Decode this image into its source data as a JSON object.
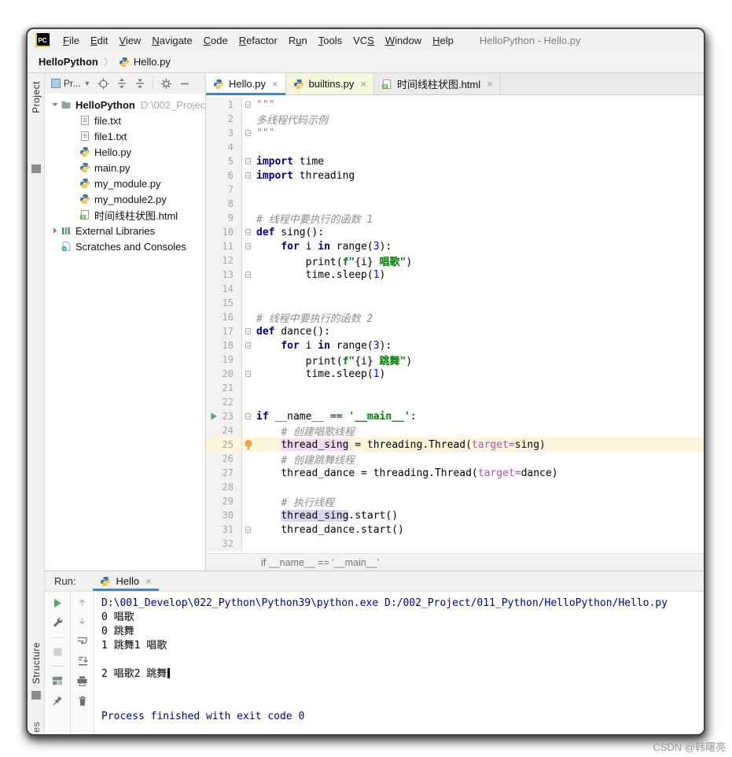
{
  "window": {
    "title": "HelloPython - Hello.py"
  },
  "menu": {
    "logo": "PC",
    "items": [
      {
        "label": "File",
        "u": 0
      },
      {
        "label": "Edit",
        "u": 0
      },
      {
        "label": "View",
        "u": 0
      },
      {
        "label": "Navigate",
        "u": 0
      },
      {
        "label": "Code",
        "u": 0
      },
      {
        "label": "Refactor",
        "u": 0
      },
      {
        "label": "Run",
        "u": 1
      },
      {
        "label": "Tools",
        "u": 0
      },
      {
        "label": "VCS",
        "u": 2
      },
      {
        "label": "Window",
        "u": 0
      },
      {
        "label": "Help",
        "u": 0
      }
    ]
  },
  "breadcrumb": {
    "project": "HelloPython",
    "separator": "〉",
    "file": "Hello.py"
  },
  "tool_stripe": {
    "top": "Project",
    "bottom": "Structure",
    "bottom_partial": "es"
  },
  "project_panel": {
    "selector_label": "Pr...",
    "tree": [
      {
        "label": "HelloPython",
        "path": "D:\\002_Projec",
        "icon": "folder",
        "level": 0,
        "bold": true,
        "chevron": "down"
      },
      {
        "label": "file.txt",
        "icon": "textfile",
        "level": 1
      },
      {
        "label": "file1.txt",
        "icon": "textfile",
        "level": 1
      },
      {
        "label": "Hello.py",
        "icon": "python",
        "level": 1
      },
      {
        "label": "main.py",
        "icon": "python",
        "level": 1
      },
      {
        "label": "my_module.py",
        "icon": "python",
        "level": 1
      },
      {
        "label": "my_module2.py",
        "icon": "python",
        "level": 1
      },
      {
        "label": "时间线柱状图.html",
        "icon": "htmlfile",
        "level": 1
      },
      {
        "label": "External Libraries",
        "icon": "lib",
        "level": 0,
        "chevron": "right"
      },
      {
        "label": "Scratches and Consoles",
        "icon": "scratch",
        "level": 0
      }
    ]
  },
  "editor": {
    "tabs": [
      {
        "label": "Hello.py",
        "icon": "python",
        "state": "active"
      },
      {
        "label": "builtins.py",
        "icon": "python",
        "state": "nonproject"
      },
      {
        "label": "时间线柱状图.html",
        "icon": "htmlfile",
        "state": "normal"
      }
    ],
    "context_bar": "if __name__ == '__main__'",
    "code": [
      {
        "seg": [
          [
            "\"\"\"",
            "com"
          ]
        ],
        "fold": true
      },
      {
        "seg": [
          [
            "多线程代码示例",
            "com"
          ]
        ]
      },
      {
        "seg": [
          [
            "\"\"\"",
            "com"
          ]
        ],
        "fold": true
      },
      {
        "seg": []
      },
      {
        "seg": [
          [
            "import",
            "kw"
          ],
          [
            " time",
            "pln"
          ]
        ],
        "fold": true
      },
      {
        "seg": [
          [
            "import",
            "kw"
          ],
          [
            " threading",
            "pln"
          ]
        ],
        "fold": true
      },
      {
        "seg": []
      },
      {
        "seg": []
      },
      {
        "seg": [
          [
            "# 线程中要执行的函数 1",
            "com"
          ]
        ]
      },
      {
        "seg": [
          [
            "def",
            "kw"
          ],
          [
            " sing():",
            "pln"
          ]
        ],
        "fold": true
      },
      {
        "seg": [
          [
            "    ",
            "pln"
          ],
          [
            "for",
            "kw"
          ],
          [
            " i ",
            "pln"
          ],
          [
            "in",
            "kw"
          ],
          [
            " range(",
            "pln"
          ],
          [
            "3",
            "num"
          ],
          [
            "):",
            "pln"
          ]
        ],
        "fold": true
      },
      {
        "seg": [
          [
            "        print(",
            "pln"
          ],
          [
            "f\"",
            "str"
          ],
          [
            "{i}",
            "pln"
          ],
          [
            " 唱歌\"",
            "str"
          ],
          [
            ")",
            "pln"
          ]
        ]
      },
      {
        "seg": [
          [
            "        time.sleep(",
            "pln"
          ],
          [
            "1",
            "num"
          ],
          [
            ")",
            "pln"
          ]
        ],
        "fold": true
      },
      {
        "seg": []
      },
      {
        "seg": []
      },
      {
        "seg": [
          [
            "# 线程中要执行的函数 2",
            "com"
          ]
        ]
      },
      {
        "seg": [
          [
            "def",
            "kw"
          ],
          [
            " dance():",
            "pln"
          ]
        ],
        "fold": true
      },
      {
        "seg": [
          [
            "    ",
            "pln"
          ],
          [
            "for",
            "kw"
          ],
          [
            " i ",
            "pln"
          ],
          [
            "in",
            "kw"
          ],
          [
            " range(",
            "pln"
          ],
          [
            "3",
            "num"
          ],
          [
            "):",
            "pln"
          ]
        ],
        "fold": true
      },
      {
        "seg": [
          [
            "        print(",
            "pln"
          ],
          [
            "f\"",
            "str"
          ],
          [
            "{i}",
            "pln"
          ],
          [
            " 跳舞\"",
            "str"
          ],
          [
            ")",
            "pln"
          ]
        ]
      },
      {
        "seg": [
          [
            "        time.sleep(",
            "pln"
          ],
          [
            "1",
            "num"
          ],
          [
            ")",
            "pln"
          ]
        ],
        "fold": true
      },
      {
        "seg": []
      },
      {
        "seg": []
      },
      {
        "seg": [
          [
            "if",
            "kw"
          ],
          [
            " __name__ == ",
            "pln"
          ],
          [
            "'__main__'",
            "str"
          ],
          [
            ":",
            "pln"
          ]
        ],
        "fold": true,
        "run": true
      },
      {
        "seg": [
          [
            "    ",
            "pln"
          ],
          [
            "# 创建唱歌线程",
            "com"
          ]
        ]
      },
      {
        "seg": [
          [
            "    ",
            "pln"
          ],
          [
            "thread_sing",
            "hlw"
          ],
          [
            " = threading.Thread(",
            "pln"
          ],
          [
            "target=",
            "prm"
          ],
          [
            "sing)",
            "pln"
          ]
        ],
        "hl": true,
        "bulb": true
      },
      {
        "seg": [
          [
            "    ",
            "pln"
          ],
          [
            "# 创建跳舞线程",
            "com"
          ]
        ]
      },
      {
        "seg": [
          [
            "    thread_dance = threading.Thread(",
            "pln"
          ],
          [
            "target=",
            "prm"
          ],
          [
            "dance)",
            "pln"
          ]
        ]
      },
      {
        "seg": []
      },
      {
        "seg": [
          [
            "    ",
            "pln"
          ],
          [
            "# 执行线程",
            "com"
          ]
        ]
      },
      {
        "seg": [
          [
            "    ",
            "pln"
          ],
          [
            "thread_sing",
            "hlr"
          ],
          [
            ".start()",
            "pln"
          ]
        ]
      },
      {
        "seg": [
          [
            "    thread_dance.start()",
            "pln"
          ]
        ],
        "fold": true
      },
      {
        "seg": []
      }
    ]
  },
  "run_panel": {
    "label": "Run:",
    "tab": "Hello",
    "console": [
      {
        "text": "D:\\001_Develop\\022_Python\\Python39\\python.exe D:/002_Project/011_Python/HelloPython/Hello.py",
        "color": "cmd"
      },
      {
        "text": "0 唱歌",
        "color": "out"
      },
      {
        "text": "0 跳舞",
        "color": "out"
      },
      {
        "text": "1 跳舞1 唱歌",
        "color": "out"
      },
      {
        "text": "",
        "color": "out"
      },
      {
        "text": "2 唱歌2 跳舞",
        "color": "out",
        "cursor": true
      },
      {
        "text": "",
        "color": "out"
      },
      {
        "text": "",
        "color": "out"
      },
      {
        "text": "Process finished with exit code 0",
        "color": "cmd"
      }
    ]
  },
  "watermark": "CSDN @韩曙亮",
  "colors": {
    "accent_blue": "#3E86C7",
    "keyword": "#000080",
    "string": "#008000",
    "comment": "#8C8C8C",
    "number": "#0000FF",
    "named_param": "#AB51BA",
    "console_system": "#00008B",
    "run_green": "#59A869",
    "current_line_bg": "#FCF5DB",
    "hl_write_bg": "#F0D9F2",
    "hl_read_bg": "#D7D7F4",
    "nonproject_tab_bg": "#F3F6DA",
    "panel_bg": "#F2F1F0"
  }
}
